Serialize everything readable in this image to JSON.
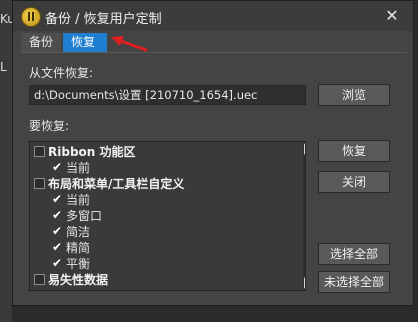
{
  "background": {
    "glyph_top": "Ku",
    "glyph_mid": "L"
  },
  "dialog": {
    "title": "备份 / 恢复用户定制",
    "close_icon": "close-icon"
  },
  "tabs": [
    {
      "label": "备份",
      "selected": false
    },
    {
      "label": "恢复",
      "selected": true
    }
  ],
  "restore": {
    "from_file_label": "从文件恢复:",
    "file_path": "d:\\Documents\\设置 [210710_1654].uec",
    "browse_button": "浏览",
    "to_restore_label": "要恢复:",
    "restore_button": "恢复",
    "close_button": "关闭",
    "select_all_button": "选择全部",
    "deselect_all_button": "未选择全部"
  },
  "tree": {
    "items": [
      {
        "label": "Ribbon 功能区",
        "group": true,
        "checked": false
      },
      {
        "label": "当前",
        "group": false,
        "checked": true
      },
      {
        "label": "布局和菜单/工具栏自定义",
        "group": true,
        "checked": false
      },
      {
        "label": "当前",
        "group": false,
        "checked": true
      },
      {
        "label": "多窗口",
        "group": false,
        "checked": true
      },
      {
        "label": "简洁",
        "group": false,
        "checked": true
      },
      {
        "label": "精简",
        "group": false,
        "checked": true
      },
      {
        "label": "平衡",
        "group": false,
        "checked": true
      },
      {
        "label": "易失性数据",
        "group": true,
        "checked": false
      }
    ]
  },
  "colors": {
    "dialog_bg": "#444444",
    "tab_selected": "#1e7fd0",
    "annotation_arrow": "#e02020"
  }
}
